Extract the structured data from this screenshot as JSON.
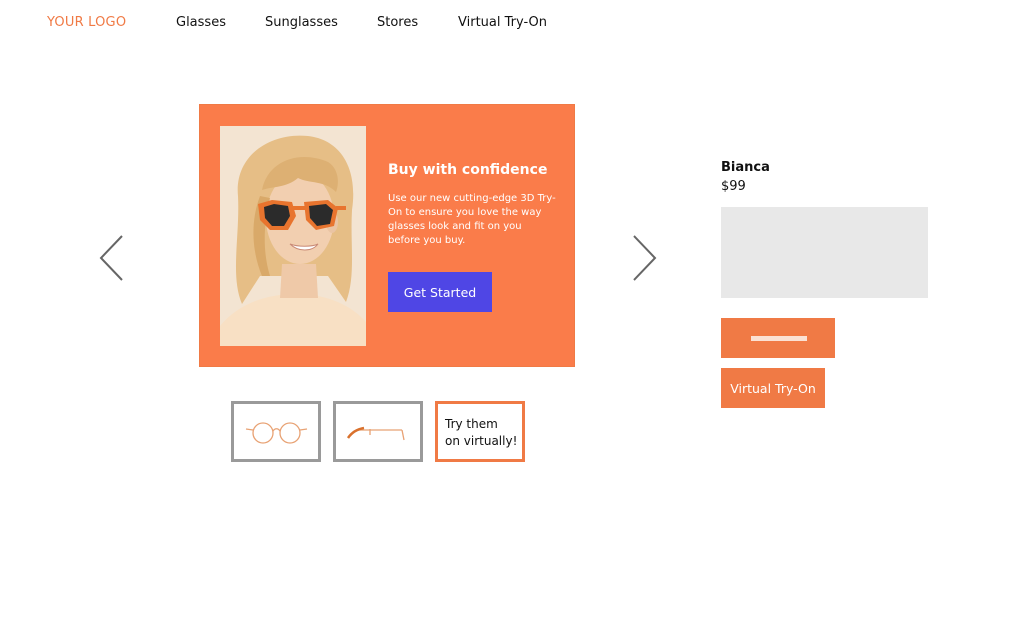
{
  "header": {
    "logo": "YOUR LOGO",
    "nav": [
      {
        "label": "Glasses"
      },
      {
        "label": "Sunglasses"
      },
      {
        "label": "Stores"
      },
      {
        "label": "Virtual Try-On"
      }
    ]
  },
  "carousel": {
    "prev_icon": "chevron-left-icon",
    "next_icon": "chevron-right-icon",
    "promo": {
      "title": "Buy with confidence",
      "body": "Use our new cutting-edge 3D Try-On to ensure you love the way glasses look and fit on you before you buy.",
      "cta_label": "Get Started"
    },
    "thumbnails": [
      {
        "icon": "glasses-front-icon"
      },
      {
        "icon": "glasses-side-icon"
      },
      {
        "label_line1": "Try them",
        "label_line2": "on virtually!"
      }
    ]
  },
  "product": {
    "name": "Bianca",
    "price": "$99",
    "virtual_try_on_label": "Virtual Try-On"
  },
  "colors": {
    "accent": "#f07a45",
    "promo_bg": "#fa7c4a",
    "cta": "#4f46e5",
    "placeholder": "#e8e8e8"
  }
}
